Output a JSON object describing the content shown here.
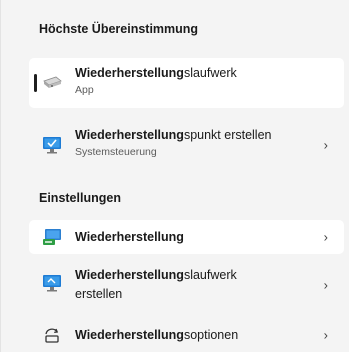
{
  "sections": {
    "best_match": "Höchste Übereinstimmung",
    "settings": "Einstellungen"
  },
  "best_match": {
    "bold": "Wiederherstellung",
    "rest": "slaufwerk",
    "sub": "App",
    "icon": "drive-icon"
  },
  "items": [
    {
      "bold": "Wiederherstellung",
      "rest": "spunkt erstellen",
      "sub": "Systemsteuerung",
      "icon": "monitor-check-icon",
      "chevron": "›"
    },
    {
      "bold": "Wiederherstellung",
      "rest": "",
      "sub": "",
      "icon": "recovery-icon",
      "chevron": "›"
    },
    {
      "bold": "Wiederherstellung",
      "rest": "slaufwerk",
      "line2": "erstellen",
      "icon": "monitor-drive-icon",
      "chevron": "›"
    },
    {
      "bold": "Wiederherstellung",
      "rest": "soptionen",
      "sub": "",
      "icon": "recovery-options-icon",
      "chevron": "›"
    }
  ]
}
